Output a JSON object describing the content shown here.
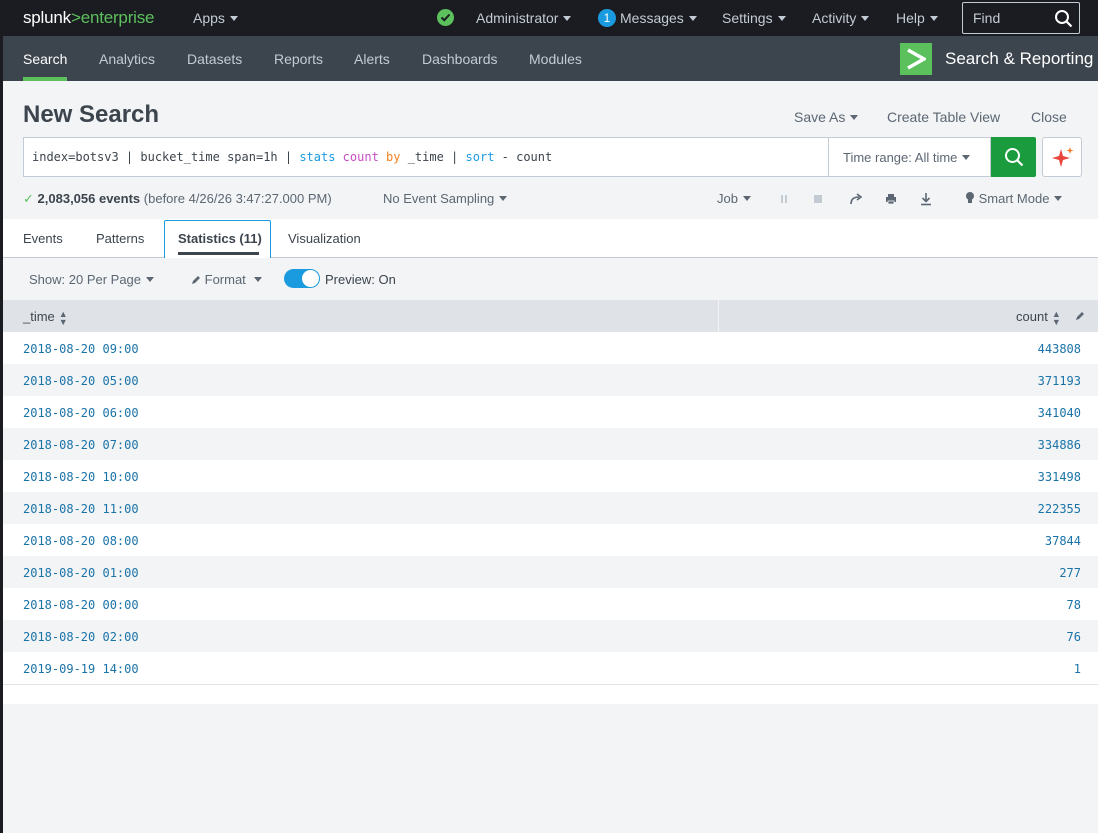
{
  "topbar": {
    "logo_main": "splunk",
    "logo_gt": ">",
    "logo_sub": "enterprise",
    "apps": "Apps",
    "user": "Administrator",
    "messages_count": "1",
    "messages": "Messages",
    "settings": "Settings",
    "activity": "Activity",
    "help": "Help",
    "find_placeholder": "Find"
  },
  "nav": {
    "items": [
      "Search",
      "Analytics",
      "Datasets",
      "Reports",
      "Alerts",
      "Dashboards",
      "Modules"
    ],
    "app_name": "Search & Reporting"
  },
  "page": {
    "title": "New Search",
    "save_as": "Save As",
    "create_table_view": "Create Table View",
    "close": "Close"
  },
  "search": {
    "q_index": "index=botsv3 | bucket_time span=1h | ",
    "q_stats": "stats",
    "q_count": "count",
    "q_by": "by",
    "q_time": " _time | ",
    "q_sort": "sort",
    "q_rest": " - count",
    "time_range": "Time range: All time"
  },
  "status": {
    "check": "✓",
    "events": "2,083,056 events",
    "before": " (before 4/26/26 3:47:27.000 PM)",
    "sampling": "No Event Sampling",
    "job": "Job",
    "smart_mode": "Smart Mode"
  },
  "tabs": {
    "events": "Events",
    "patterns": "Patterns",
    "statistics": "Statistics (11)",
    "visualization": "Visualization"
  },
  "options": {
    "show": "Show: 20 Per Page",
    "format": "Format",
    "preview": "Preview: On",
    "preview_on": true
  },
  "table": {
    "col_time": "_time",
    "col_count": "count",
    "rows": [
      {
        "time": "2018-08-20 09:00",
        "count": "443808"
      },
      {
        "time": "2018-08-20 05:00",
        "count": "371193"
      },
      {
        "time": "2018-08-20 06:00",
        "count": "341040"
      },
      {
        "time": "2018-08-20 07:00",
        "count": "334886"
      },
      {
        "time": "2018-08-20 10:00",
        "count": "331498"
      },
      {
        "time": "2018-08-20 11:00",
        "count": "222355"
      },
      {
        "time": "2018-08-20 08:00",
        "count": "37844"
      },
      {
        "time": "2018-08-20 01:00",
        "count": "277"
      },
      {
        "time": "2018-08-20 00:00",
        "count": "78"
      },
      {
        "time": "2018-08-20 02:00",
        "count": "76"
      },
      {
        "time": "2019-09-19 14:00",
        "count": "1"
      }
    ]
  },
  "colors": {
    "accent_green": "#5cc05c",
    "search_button": "#1a9c3e",
    "link_blue": "#1a73a8",
    "toggle_blue": "#1a9be0"
  }
}
